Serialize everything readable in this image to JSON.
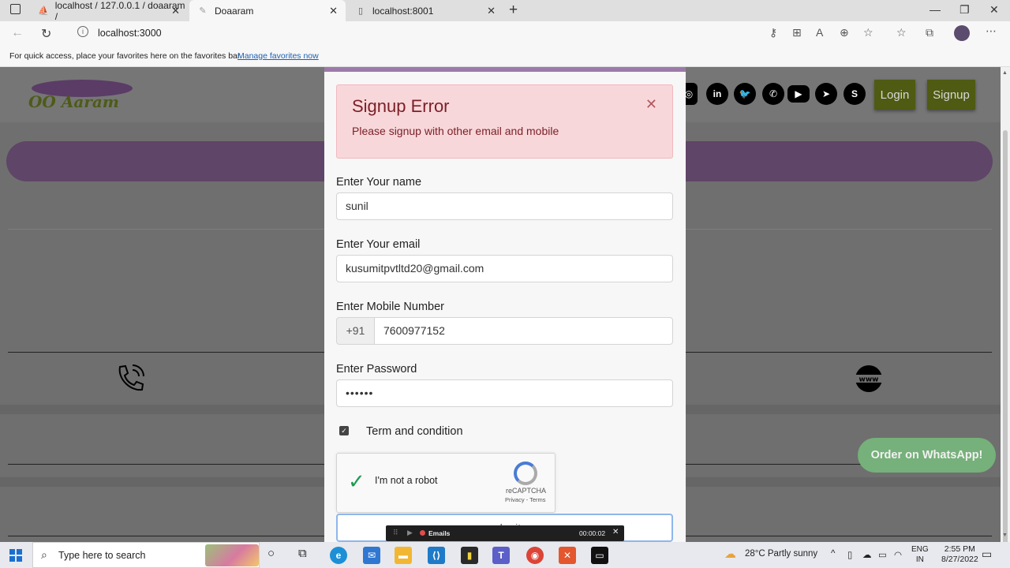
{
  "browser": {
    "tabs": [
      {
        "title": "localhost / 127.0.0.1 / doaaram /",
        "icon": "phpmyadmin-icon"
      },
      {
        "title": "Doaaram",
        "icon": "site-icon",
        "active": true
      },
      {
        "title": "localhost:8001",
        "icon": "page-icon"
      }
    ],
    "url": "localhost:3000",
    "favorites_message": "For quick access, place your favorites here on the favorites bar.",
    "favorites_link": "Manage favorites now"
  },
  "site": {
    "logo_text": "Aaram",
    "login_label": "Login",
    "signup_label": "Signup",
    "social_icons": [
      "instagram-icon",
      "linkedin-icon",
      "twitter-icon",
      "whatsapp-icon",
      "youtube-icon",
      "telegram-icon",
      "skype-icon"
    ],
    "whatsapp_button": "Order on WhatsApp!"
  },
  "modal": {
    "alert_title": "Signup Error",
    "alert_message": "Please signup with other email and mobile",
    "name_label": "Enter Your name",
    "name_value": "sunil",
    "email_label": "Enter Your email",
    "email_value": "kusumitpvtltd20@gmail.com",
    "mobile_label": "Enter Mobile Number",
    "mobile_prefix": "+91",
    "mobile_value": "7600977152",
    "password_label": "Enter Password",
    "password_value": "••••••",
    "terms_label": "Term and condition",
    "terms_checked": true,
    "recaptcha_label": "I'm not a robot",
    "recaptcha_brand": "reCAPTCHA",
    "recaptcha_terms": "Privacy - Terms",
    "submit_label": "submit"
  },
  "recorder": {
    "name": "Emails",
    "time": "00:00:02"
  },
  "taskbar": {
    "search_placeholder": "Type here to search",
    "weather": "28°C  Partly sunny",
    "lang_top": "ENG",
    "lang_bottom": "IN",
    "time": "2:55 PM",
    "date": "8/27/2022"
  }
}
